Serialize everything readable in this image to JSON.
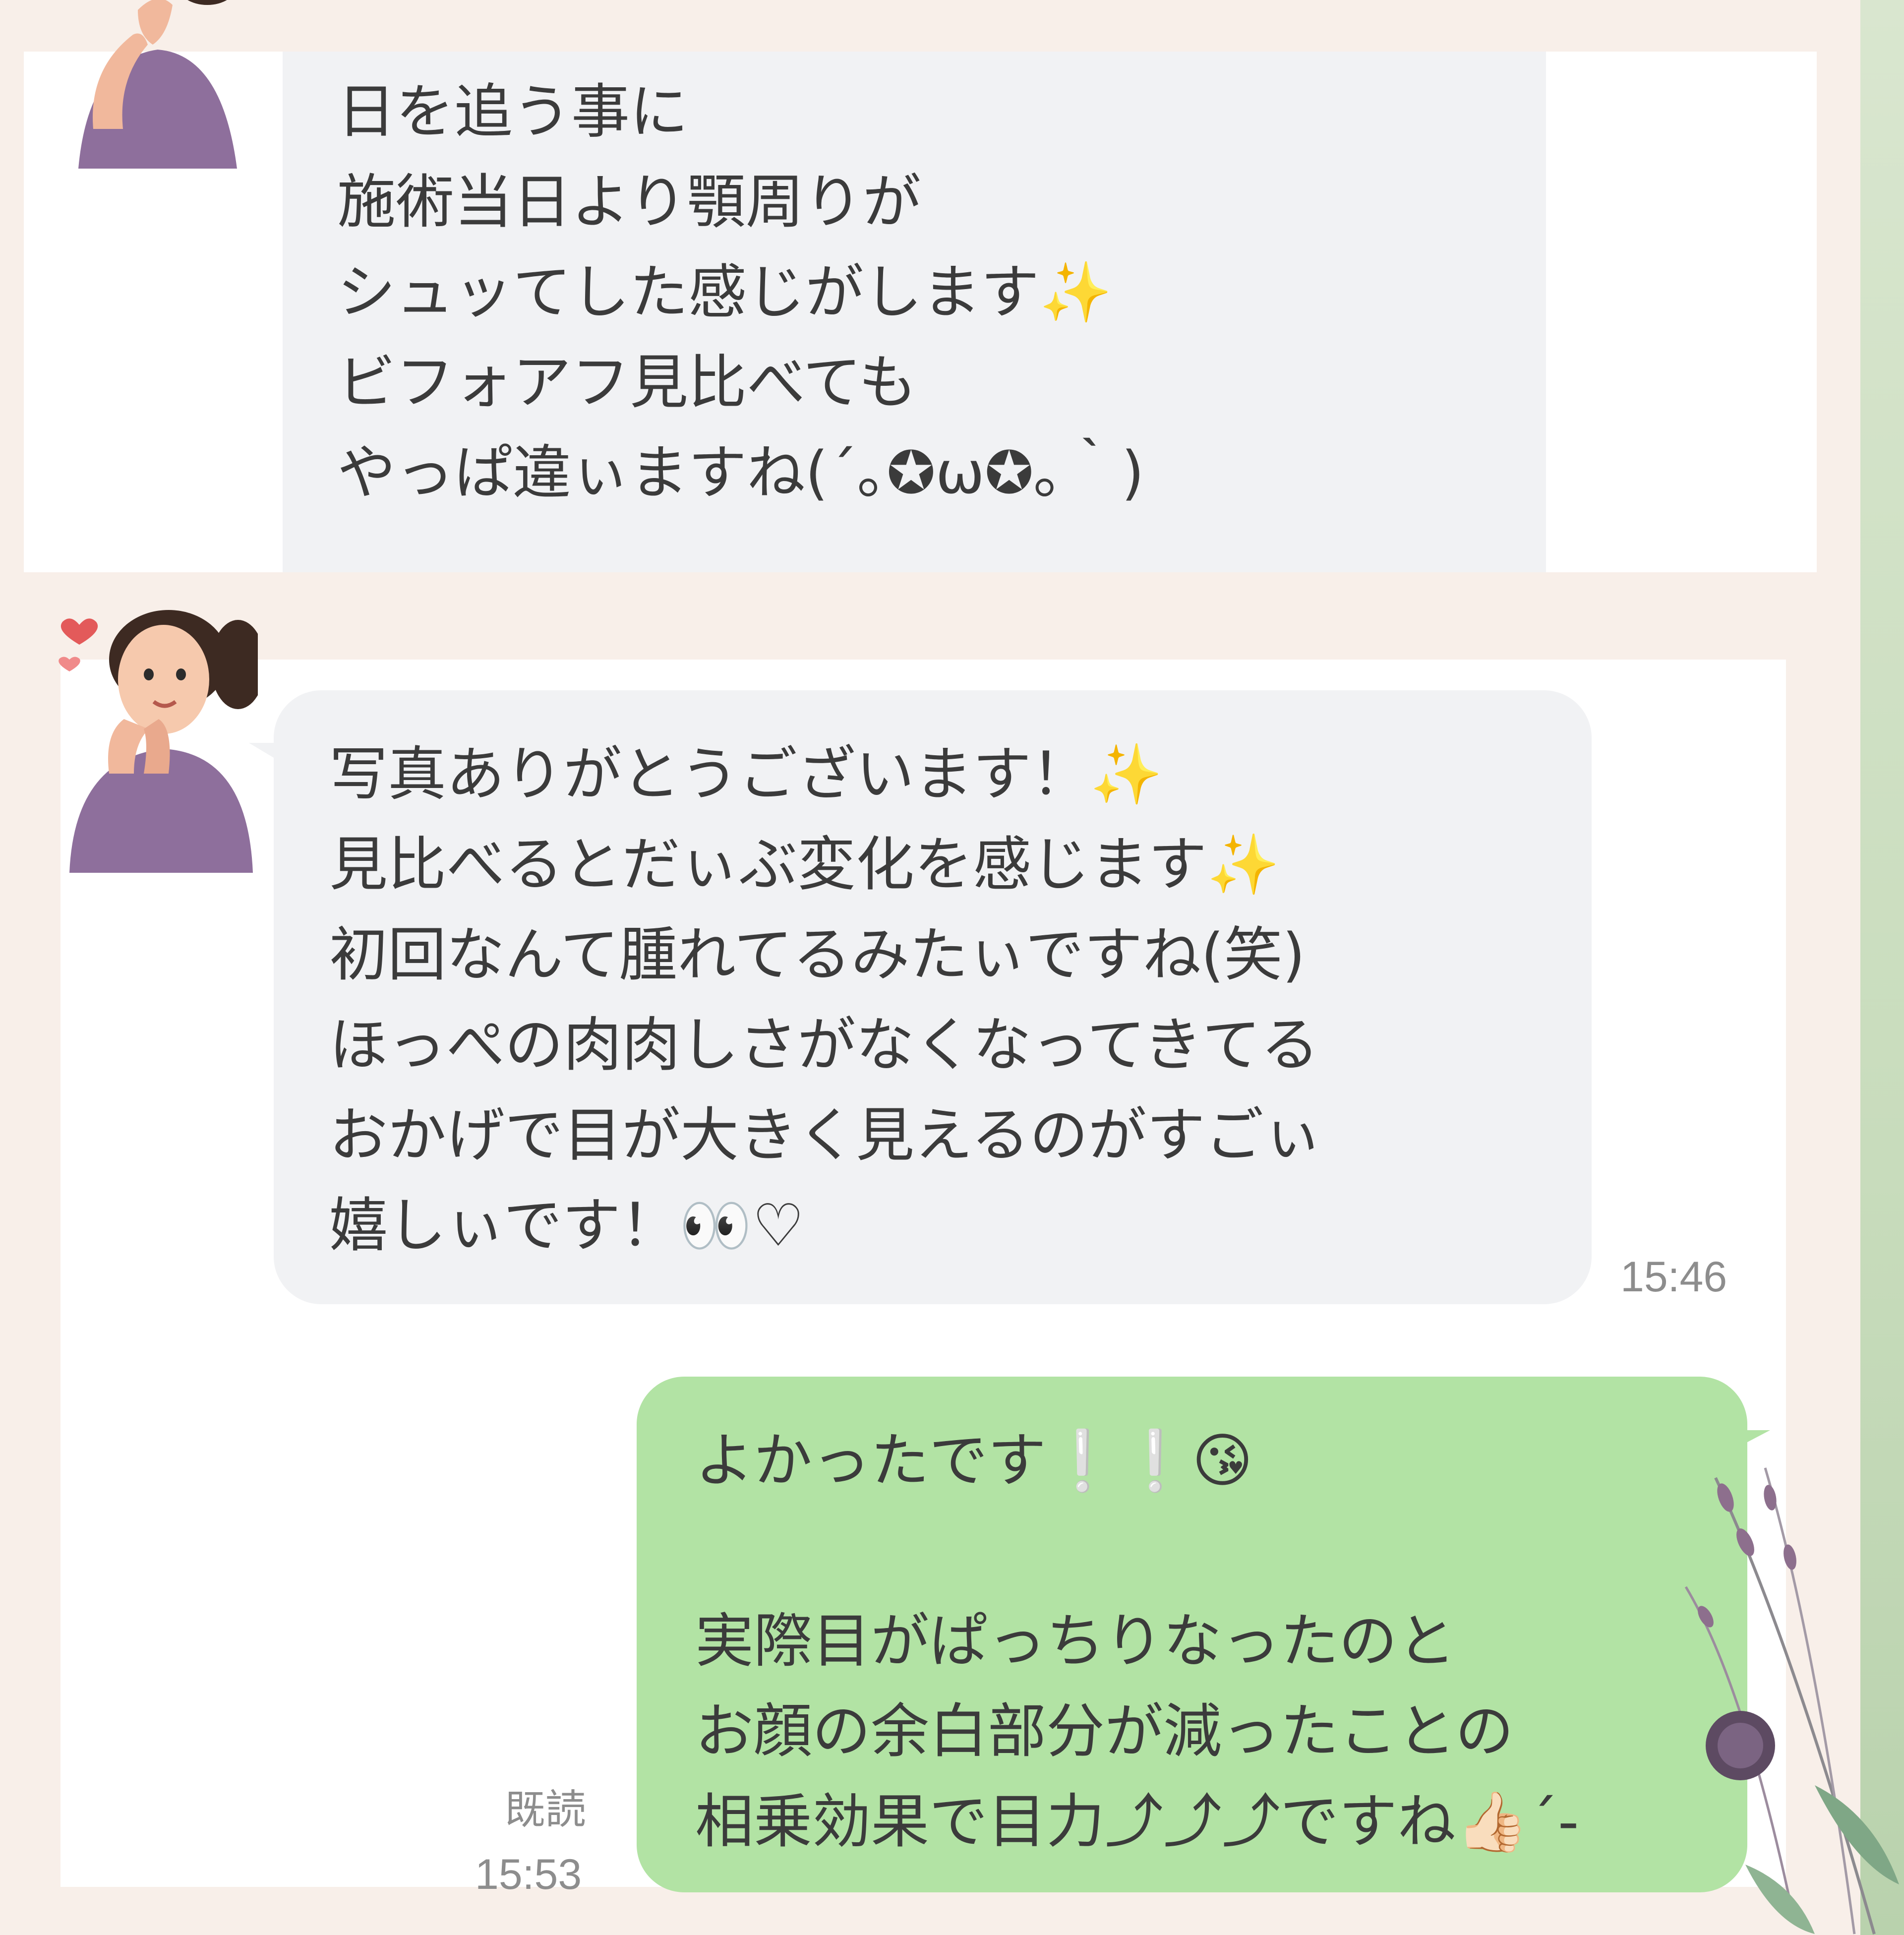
{
  "chat": {
    "message_top": {
      "text": "日を追う事に\n施術当日より顎周りが\nシュッてした感じがします✨\nビフォアフ見比べても\nやっぱ違ぃますね(´｡✪ω✪｡｀)"
    },
    "message_in": {
      "text": "写真ありがとうございます！✨\n見比べるとだぃぶ変化を感じます✨\n初回なんて腫れてるみたぃですね(笑)\nほっぺの肉肉しさがなくなってきてる\nおかげで目が大きく見えるのがすごぃ\n嬉しぃです！👀♡",
      "time": "15:46"
    },
    "message_out": {
      "text": "よかったです❕❕😘\n\n実際目がぱっちりなったのと\nお顔の余白部分が減ったことの\n相乗効果で目力⤴︎⤴︎⤴︎ですね👍🏻´-",
      "read_label": "既読",
      "time": "15:53"
    }
  },
  "colors": {
    "incoming_bubble": "#f1f2f4",
    "outgoing_bubble": "#b2e3a4",
    "page_background": "#f8efe9",
    "accent_bar": "#c8dcbc"
  },
  "icons": {
    "avatar": "woman-avatar-icon",
    "heart": "heart-icon",
    "decoration": "flower-sprig-decoration"
  }
}
